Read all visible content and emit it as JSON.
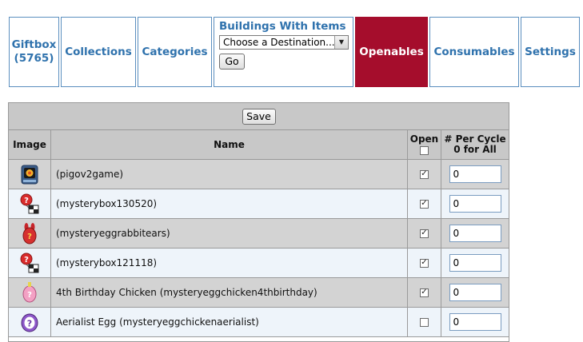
{
  "tabs": {
    "giftbox": "Giftbox\n(5765)",
    "collections": "Collections",
    "categories": "Categories",
    "openables": "Openables",
    "consumables": "Consumables",
    "settings": "Settings"
  },
  "buildings": {
    "title": "Buildings With Items",
    "select_value": "Choose a Destination...",
    "go_label": "Go"
  },
  "table": {
    "save_label": "Save",
    "headers": {
      "image": "Image",
      "name": "Name",
      "open": "Open",
      "per_cycle_line1": "# Per Cycle",
      "per_cycle_line2": "0 for All"
    },
    "rows": [
      {
        "name": "(pigov2game)",
        "icon": "arcade-machine-icon",
        "open": true,
        "per_cycle": "0"
      },
      {
        "name": "(mysterybox130520)",
        "icon": "mystery-gift-balloon-icon",
        "open": true,
        "per_cycle": "0"
      },
      {
        "name": "(mysteryeggrabbitears)",
        "icon": "mystery-egg-rabbit-ears-icon",
        "open": true,
        "per_cycle": "0"
      },
      {
        "name": "(mysterybox121118)",
        "icon": "mystery-gift-balloon-icon",
        "open": true,
        "per_cycle": "0"
      },
      {
        "name": "4th Birthday Chicken (mysteryeggchicken4thbirthday)",
        "icon": "mystery-egg-birthday-icon",
        "open": true,
        "per_cycle": "0"
      },
      {
        "name": "Aerialist Egg (mysteryeggchickenaerialist)",
        "icon": "mystery-egg-aerialist-icon",
        "open": false,
        "per_cycle": "0"
      }
    ]
  },
  "colors": {
    "tab_text": "#2f72ad",
    "active_tab": "#a50d2c",
    "header_bg": "#c8c8c8",
    "row_gray": "#d3d3d3",
    "row_blue": "#eef4fa"
  }
}
